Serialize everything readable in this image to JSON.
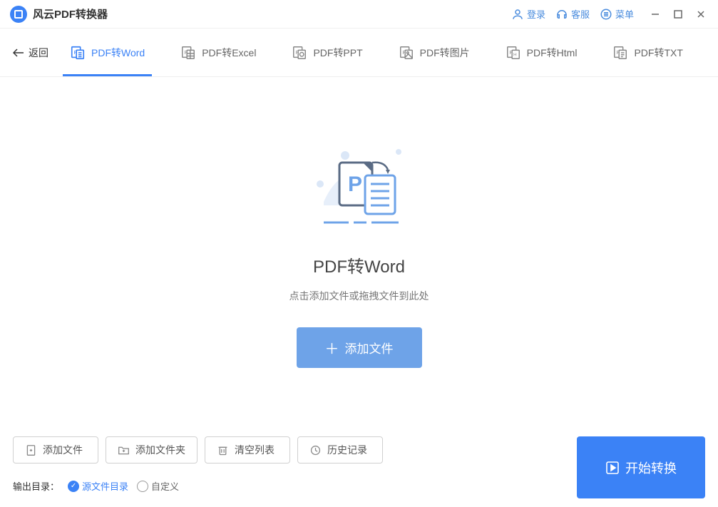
{
  "app": {
    "title": "风云PDF转换器"
  },
  "titlebar": {
    "login": "登录",
    "service": "客服",
    "menu": "菜单"
  },
  "nav": {
    "back": "返回",
    "tabs": [
      {
        "label": "PDF转Word",
        "active": true
      },
      {
        "label": "PDF转Excel"
      },
      {
        "label": "PDF转PPT"
      },
      {
        "label": "PDF转图片"
      },
      {
        "label": "PDF转Html"
      },
      {
        "label": "PDF转TXT"
      }
    ]
  },
  "main": {
    "heading": "PDF转Word",
    "hint": "点击添加文件或拖拽文件到此处",
    "add_button": "添加文件"
  },
  "toolbar": {
    "add_file": "添加文件",
    "add_folder": "添加文件夹",
    "clear_list": "清空列表",
    "history": "历史记录"
  },
  "output": {
    "label": "输出目录：",
    "opt_source": "源文件目录",
    "opt_custom": "自定义"
  },
  "start_button": "开始转换"
}
